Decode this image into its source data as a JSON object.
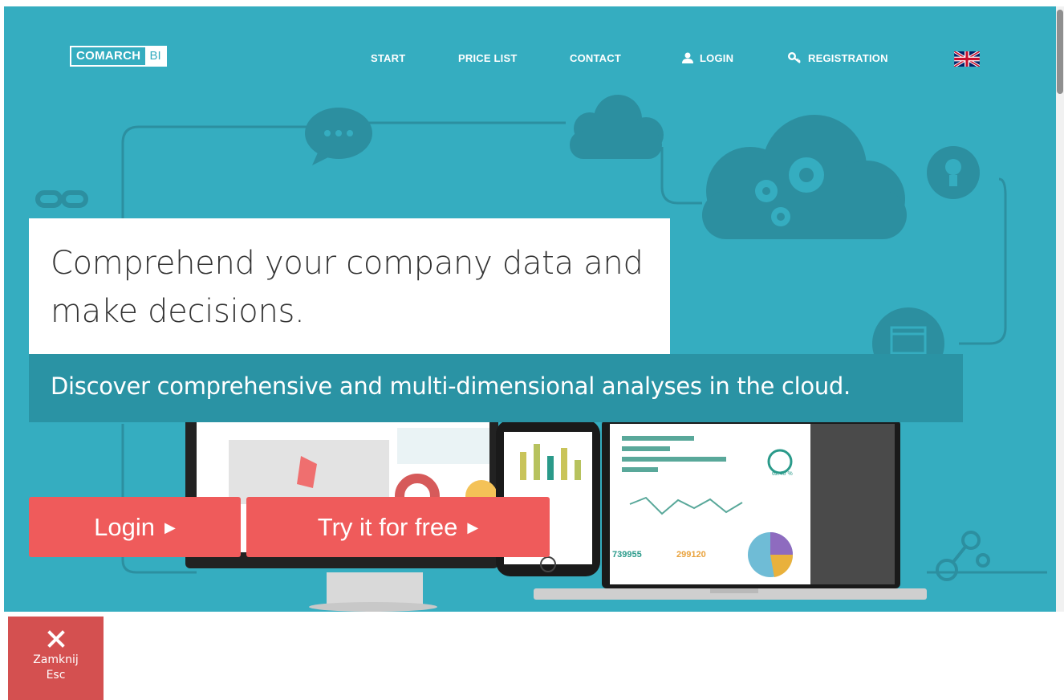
{
  "logo": {
    "brand": "COMARCH",
    "suffix": "BI"
  },
  "nav": {
    "start": "START",
    "price_list": "PRICE LIST",
    "contact": "CONTACT",
    "login": "LOGIN",
    "registration": "REGISTRATION",
    "language_flag": "uk-flag-icon"
  },
  "hero": {
    "headline": "Comprehend your company data and make decisions.",
    "tagline": "Discover comprehensive and multi-dimensional analyses in the cloud.",
    "login_button": "Login",
    "trial_button": "Try it for free",
    "arrow": "▶"
  },
  "dashboard_values": {
    "kpi_1": "739955",
    "kpi_2": "299120",
    "gauge": "62.40 %"
  },
  "close": {
    "label": "Zamknij",
    "key": "Esc"
  },
  "colors": {
    "hero_bg": "#35adc0",
    "tagline_bg": "#2a93a4",
    "cta": "#ef5b5b",
    "close_bg": "#d45050"
  }
}
